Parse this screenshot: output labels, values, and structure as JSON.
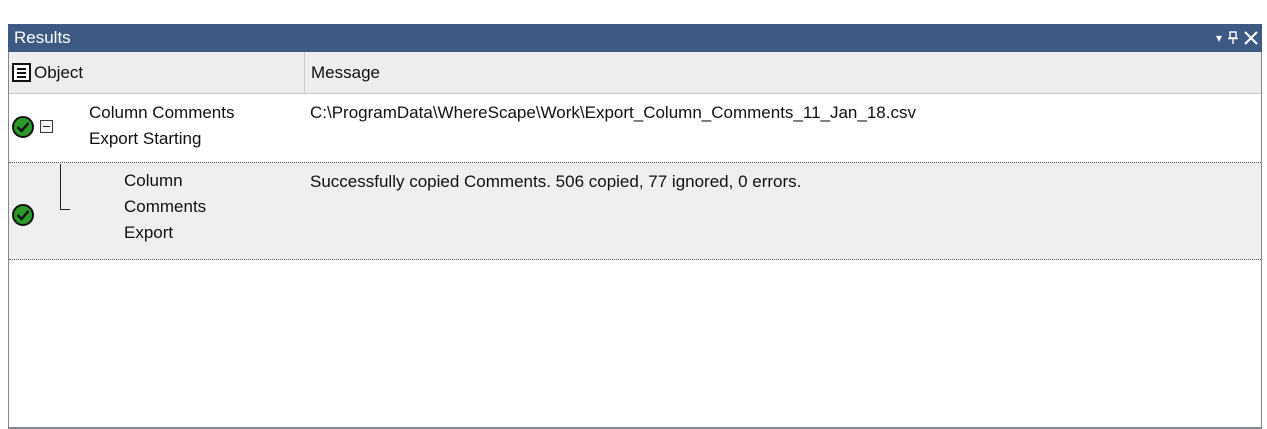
{
  "window": {
    "title": "Results",
    "controls": {
      "dropdown_glyph": "▾",
      "pin_glyph": "ᛘ",
      "close_glyph": "✕"
    },
    "title_bar_color": "#3e5a82"
  },
  "grid": {
    "columns": [
      {
        "key": "object",
        "label": "Object"
      },
      {
        "key": "message",
        "label": "Message"
      }
    ],
    "rows": [
      {
        "status": "success",
        "status_icon": "green-check-icon",
        "expanded": true,
        "object": "Column Comments\nExport Starting",
        "message": "C:\\ProgramData\\WhereScape\\Work\\Export_Column_Comments_11_Jan_18.csv"
      },
      {
        "status": "success",
        "status_icon": "green-check-icon",
        "selected": true,
        "object": "Column\nComments\nExport",
        "message": "Successfully copied Comments. 506 copied, 77 ignored, 0 errors."
      }
    ]
  },
  "colors": {
    "success": "#2a9a2a",
    "selected_row": "#efefef",
    "header_bg": "#ededed"
  }
}
